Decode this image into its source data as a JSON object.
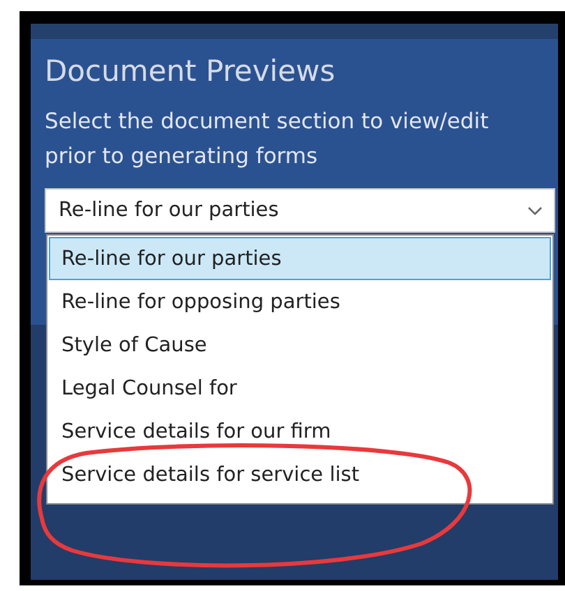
{
  "panel": {
    "title": "Document Previews",
    "description": "Select the document section to view/edit prior to generating forms"
  },
  "dropdown": {
    "value": "Re-line for our parties",
    "expanded": true,
    "options": [
      {
        "label": "Re-line for our parties",
        "selected": true
      },
      {
        "label": "Re-line for opposing parties",
        "selected": false
      },
      {
        "label": "Style of Cause",
        "selected": false
      },
      {
        "label": "Legal Counsel for",
        "selected": false
      },
      {
        "label": "Service details for our firm",
        "selected": false
      },
      {
        "label": "Service details for service list",
        "selected": false
      }
    ]
  },
  "annotations": [
    {
      "kind": "ellipse",
      "color": "#e8393c"
    }
  ]
}
